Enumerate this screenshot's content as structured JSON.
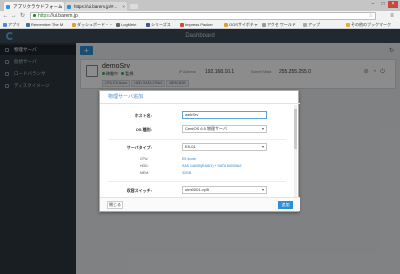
{
  "browser": {
    "tabs": [
      {
        "title": "アプリクラウドフォーム",
        "active": true,
        "favicon_color": "#3d8fd5"
      },
      {
        "title": "https://ui.barem.jp/#...",
        "active": false,
        "favicon_color": "#2d8fd5"
      }
    ],
    "url_scheme": "https",
    "url_rest": "://ui.barem.jp",
    "bookmarks": [
      {
        "label": "アプリ",
        "color": "#4a89dc"
      },
      {
        "label": "Remember The M",
        "color": "#3a6fb0"
      },
      {
        "label": "ダッシュボード・・",
        "color": "#e0a030"
      },
      {
        "label": "LogMein",
        "color": "#666666"
      },
      {
        "label": "シリーズス",
        "color": "#3b5998"
      },
      {
        "label": "Impress Packer",
        "color": "#d04a3a"
      },
      {
        "label": "OOSサイボチャ",
        "color": "#e0a030"
      },
      {
        "label": "アクセ ワールド",
        "color": "#999999"
      },
      {
        "label": "アップ",
        "color": "#aaaaaa"
      },
      {
        "label": "その他のブックマーク",
        "color": "#e0b040"
      }
    ]
  },
  "app": {
    "header_title": "Dashboard",
    "sidebar": [
      {
        "label": "物理サーバ",
        "active": true
      },
      {
        "label": "仮想サーバ",
        "active": false
      },
      {
        "label": "ロードバランサ",
        "active": false
      },
      {
        "label": "ディスクイメージ",
        "active": false
      }
    ],
    "add_button": "+",
    "refresh_icon": "↻",
    "server": {
      "name": "demoSrv",
      "status1": "稼働中",
      "status2": "監視",
      "ip_label": "IP Address",
      "ip_value": "192.168.10.1",
      "subnet_label": "Subnet Mask",
      "subnet_value": "255.255.255.0",
      "chips": [
        "CPU  E5 4core",
        "HDD  SATA 2TBx2",
        "MEM  8GB"
      ]
    }
  },
  "modal": {
    "title": "物理サーバ追加",
    "hostname_label": "ホスト名:",
    "hostname_value": "webSrv",
    "os_label": "OS 種別:",
    "os_value": "CentOS 6.5 物理サーバ",
    "server_type_label": "サーバタイプ:",
    "server_type_value": "E5-01",
    "cpu_label": "CPU:",
    "cpu_value": "E5 4core",
    "hdd_label": "HDD:",
    "hdd_value": "SAS 146GB(RAID1) + SATA 500GBx2",
    "mem_label": "MEM:",
    "mem_value": "32GB",
    "switch_label": "収容スイッチ:",
    "switch_value": "utm0001-vyl5",
    "close_button": "閉じる",
    "add_button": "追加"
  },
  "colors": {
    "accent": "#2d8fd5",
    "topbar": "#3d4a56",
    "sidebar": "#2e3740",
    "status_green": "#2db34a"
  }
}
